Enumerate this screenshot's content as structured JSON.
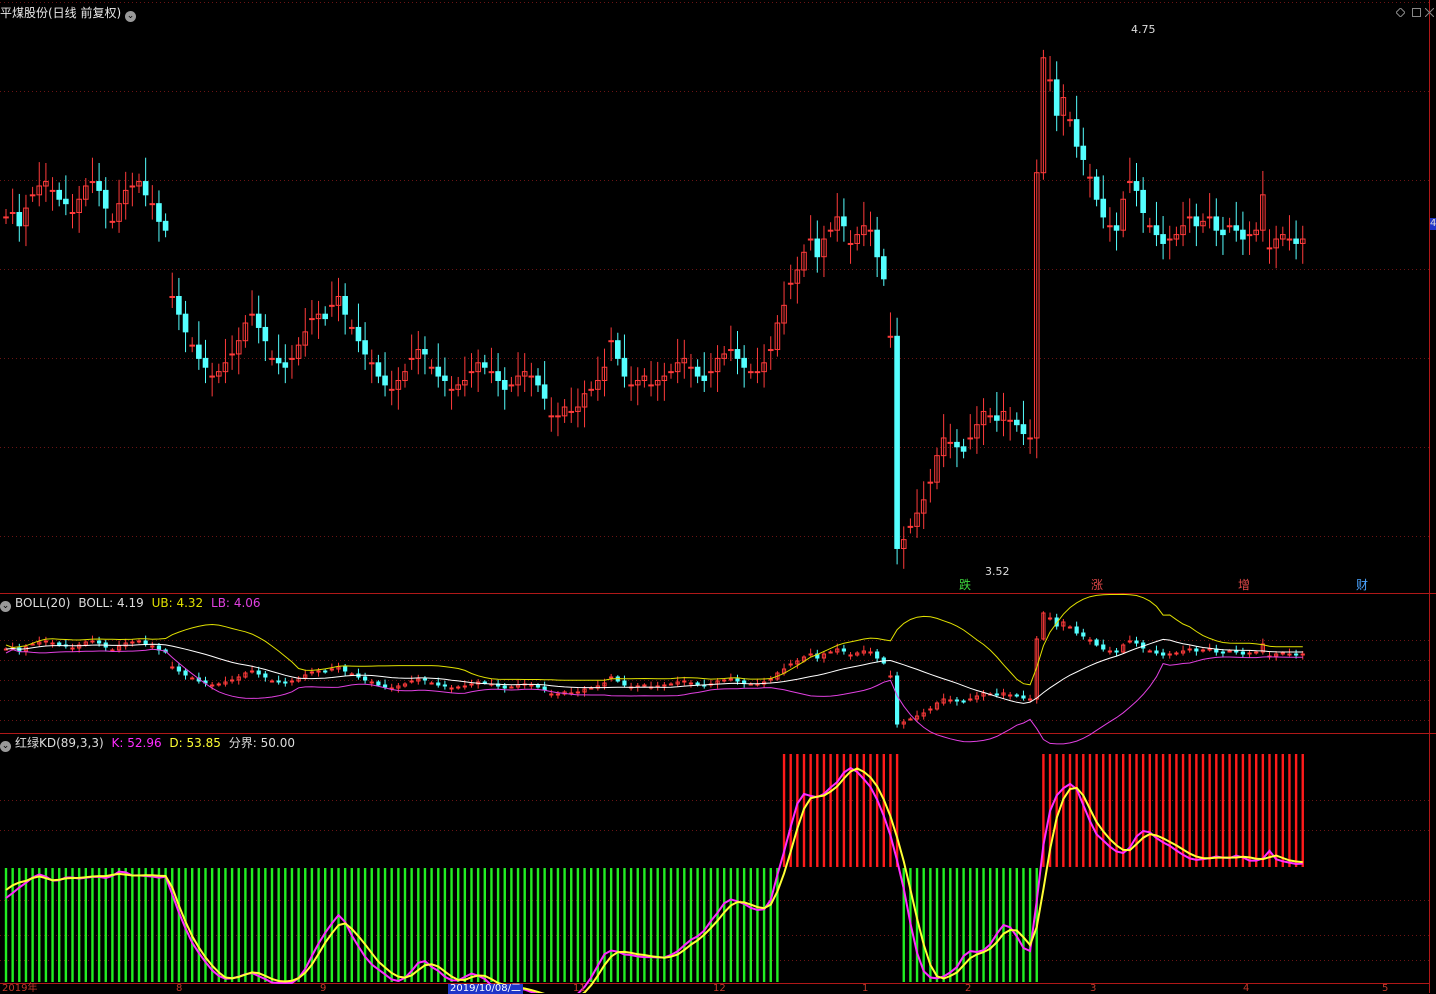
{
  "header": {
    "stock_title": "平煤股份(日线 前复权)"
  },
  "boll": {
    "name": "BOLL(20)",
    "mid_label": "BOLL:",
    "mid": "4.19",
    "ub_label": "UB:",
    "ub": "4.32",
    "lb_label": "LB:",
    "lb": "4.06"
  },
  "kd": {
    "name": "红绿KD(89,3,3)",
    "k_label": "K:",
    "k": "52.96",
    "d_label": "D:",
    "d": "53.85",
    "split_label": "分界:",
    "split": "50.00"
  },
  "price_marks": {
    "high": "4.75",
    "low": "3.52"
  },
  "events": [
    {
      "text": "跌",
      "color": "#3dd63d"
    },
    {
      "text": "涨",
      "color": "#e04848"
    },
    {
      "text": "增",
      "color": "#e04848"
    },
    {
      "text": "财",
      "color": "#4aa3ff"
    }
  ],
  "x_axis": {
    "year": "2019年",
    "selected_date": "2019/10/08/二",
    "months": [
      "8",
      "9",
      "11",
      "12",
      "1",
      "2",
      "3",
      "4",
      "5"
    ]
  },
  "right_edge_value": "4",
  "colors": {
    "up": "#ff3b3b",
    "down": "#54ffff",
    "boll_mid": "#ffffff",
    "boll_ub": "#e0e000",
    "boll_lb": "#e040e0",
    "k_line": "#ff2cff",
    "d_line": "#ffff33",
    "red_bar": "#ff1a1a",
    "green_bar": "#22ee22",
    "frame": "#b01818"
  },
  "chart_data": {
    "type": "candlestick",
    "series": [
      {
        "name": "candles",
        "values": [
          4.31,
          4.32,
          4.29,
          4.33,
          4.36,
          4.38,
          4.39,
          4.37,
          4.35,
          4.34,
          4.32,
          4.35,
          4.38,
          4.39,
          4.37,
          4.33,
          4.3,
          4.34,
          4.37,
          4.38,
          4.39,
          4.36,
          4.34,
          4.3,
          4.28,
          4.13,
          4.09,
          4.05,
          4.02,
          3.99,
          3.97,
          3.95,
          3.96,
          3.98,
          4.0,
          4.03,
          4.07,
          4.09,
          4.06,
          4.03,
          3.99,
          3.98,
          3.97,
          3.99,
          4.02,
          4.05,
          4.08,
          4.09,
          4.08,
          4.11,
          4.13,
          4.09,
          4.06,
          4.03,
          4.0,
          3.98,
          3.95,
          3.93,
          3.92,
          3.94,
          3.96,
          3.99,
          4.01,
          4.0,
          3.97,
          3.95,
          3.94,
          3.92,
          3.93,
          3.94,
          3.96,
          3.98,
          3.97,
          3.96,
          3.94,
          3.92,
          3.93,
          3.95,
          3.96,
          3.95,
          3.93,
          3.9,
          3.86,
          3.86,
          3.88,
          3.87,
          3.88,
          3.91,
          3.92,
          3.94,
          3.97,
          4.03,
          3.99,
          3.95,
          3.93,
          3.94,
          3.95,
          3.93,
          3.94,
          3.95,
          3.96,
          3.98,
          3.99,
          3.97,
          3.95,
          3.94,
          3.96,
          3.99,
          4.0,
          4.01,
          3.99,
          3.97,
          3.96,
          3.96,
          3.98,
          4.01,
          4.07,
          4.11,
          4.16,
          4.19,
          4.23,
          4.26,
          4.22,
          4.26,
          4.28,
          4.31,
          4.29,
          4.25,
          4.27,
          4.29,
          4.28,
          4.22,
          4.17,
          4.04,
          3.56,
          3.58,
          3.61,
          3.64,
          3.67,
          3.71,
          3.77,
          3.81,
          3.8,
          3.79,
          3.78,
          3.81,
          3.84,
          3.87,
          3.86,
          3.85,
          3.87,
          3.85,
          3.84,
          3.82,
          3.81,
          4.41,
          4.67,
          4.62,
          4.54,
          4.58,
          4.53,
          4.47,
          4.44,
          4.4,
          4.35,
          4.31,
          4.29,
          4.28,
          4.35,
          4.39,
          4.37,
          4.32,
          4.29,
          4.27,
          4.25,
          4.26,
          4.27,
          4.29,
          4.31,
          4.29,
          4.3,
          4.31,
          4.28,
          4.27,
          4.29,
          4.28,
          4.26,
          4.27,
          4.28,
          4.36,
          4.24,
          4.26,
          4.27,
          4.26,
          4.25,
          4.26
        ]
      },
      {
        "name": "K",
        "values": [
          30.0,
          33.3,
          37.0,
          40.2,
          43.7,
          45.7,
          44.2,
          41.6,
          41.8,
          43.7,
          43.7,
          42.9,
          43.5,
          44.1,
          44.1,
          43.3,
          44.8,
          47.6,
          47.1,
          45.0,
          45.1,
          44.7,
          44.3,
          43.6,
          44.2,
          32.4,
          20.3,
          9.6,
          0.2,
          -6.7,
          -12.7,
          -18.2,
          -21.9,
          -23.8,
          -23.5,
          -22.4,
          -20.8,
          -20.0,
          -22.1,
          -24.1,
          -26.4,
          -26.7,
          -26.7,
          -26.7,
          -23.3,
          -17.3,
          -8.6,
          -0.3,
          6.8,
          13.1,
          18.6,
          13.9,
          5.0,
          -2.3,
          -9.2,
          -14.3,
          -17.7,
          -20.9,
          -24.3,
          -25.3,
          -23.2,
          -18.5,
          -13.2,
          -12.1,
          -15.9,
          -18.6,
          -22.5,
          -24.8,
          -24.9,
          -22.6,
          -20.4,
          -21.8,
          -24.0,
          -28.2,
          -30.3,
          -30.0,
          -29.6,
          -30.2,
          -31.1,
          -32.7,
          -34.0,
          -35.7,
          -38.0,
          -39.5,
          -39.2,
          -37.4,
          -33.8,
          -29.2,
          -22.9,
          -15.0,
          -7.4,
          -5.0,
          -5.8,
          -7.7,
          -8.0,
          -9.0,
          -9.4,
          -9.3,
          -9.7,
          -9.6,
          -8.0,
          -5.5,
          -1.5,
          2.2,
          4.5,
          8.3,
          14.7,
          20.2,
          26.5,
          29.1,
          27.8,
          26.1,
          23.5,
          22.0,
          22.5,
          28.8,
          45.5,
          61.0,
          77.5,
          92.9,
          99.4,
          98.1,
          97.2,
          99.4,
          103.7,
          107.3,
          113.7,
          116.7,
          114.1,
          109.2,
          104.0,
          95.5,
          84.7,
          71.6,
          55.0,
          36.1,
          13.2,
          -6.7,
          -18.8,
          -23.0,
          -23.5,
          -22.3,
          -19.6,
          -15.9,
          -8.6,
          -5.4,
          -6.0,
          -4.8,
          -0.9,
          6.2,
          12.0,
          10.5,
          4.4,
          -3.3,
          -5.3,
          28.4,
          65.3,
          87.9,
          98.4,
          103.2,
          106.0,
          102.6,
          92.0,
          81.2,
          72.4,
          68.3,
          64.2,
          61.0,
          60.0,
          63.7,
          71.0,
          74.7,
          73.8,
          69.9,
          67.1,
          64.8,
          61.7,
          58.8,
          56.4,
          55.4,
          55.9,
          56.6,
          57.7,
          56.9,
          56.7,
          58.2,
          57.1,
          54.9,
          54.9,
          56.3,
          61.5,
          55.8,
          54.5,
          53.6,
          52.7,
          53.0
        ]
      },
      {
        "name": "D",
        "values": [
          35.4,
          38.5,
          40.3,
          41.4,
          43.3,
          44.4,
          43.2,
          41.8,
          42.2,
          43.1,
          43.3,
          43.4,
          43.8,
          44.3,
          44.6,
          44.6,
          45.4,
          46.1,
          45.6,
          45.0,
          45.0,
          45.2,
          45.2,
          44.8,
          44.7,
          36.9,
          24.9,
          14.1,
          4.6,
          -3.1,
          -9.6,
          -15.1,
          -19.6,
          -23.0,
          -23.5,
          -22.6,
          -21.1,
          -19.6,
          -20.1,
          -21.9,
          -24.0,
          -25.3,
          -25.7,
          -25.2,
          -23.4,
          -19.8,
          -14.3,
          -7.2,
          0.2,
          6.5,
          11.9,
          13.1,
          9.5,
          4.5,
          -0.9,
          -6.8,
          -12.4,
          -16.3,
          -20.0,
          -22.4,
          -23.1,
          -21.5,
          -18.0,
          -14.8,
          -14.2,
          -15.7,
          -19.1,
          -22.3,
          -24.6,
          -24.6,
          -22.8,
          -21.7,
          -21.9,
          -24.1,
          -26.7,
          -28.1,
          -28.9,
          -29.6,
          -30.3,
          -31.4,
          -32.6,
          -33.9,
          -35.9,
          -37.9,
          -38.9,
          -38.4,
          -36.2,
          -33.0,
          -28.1,
          -21.7,
          -14.7,
          -9.1,
          -6.1,
          -5.9,
          -6.5,
          -7.5,
          -8.0,
          -8.8,
          -9.3,
          -9.8,
          -9.1,
          -7.7,
          -4.7,
          -1.1,
          1.8,
          5.6,
          10.1,
          14.9,
          20.4,
          25.1,
          27.3,
          27.1,
          25.6,
          23.9,
          23.2,
          25.7,
          34.3,
          46.5,
          60.9,
          76.5,
          89.5,
          96.6,
          97.6,
          98.3,
          101.0,
          104.5,
          109.7,
          114.4,
          116.3,
          114.1,
          110.4,
          104.4,
          95.6,
          84.4,
          70.4,
          54.3,
          35.7,
          16.2,
          -1.0,
          -14.7,
          -22.2,
          -23.7,
          -22.0,
          -19.6,
          -14.8,
          -10.0,
          -7.6,
          -6.1,
          -3.8,
          0.6,
          6.2,
          8.7,
          8.3,
          3.8,
          -1.3,
          10.8,
          35.8,
          62.2,
          83.5,
          96.1,
          102.7,
          103.4,
          98.4,
          89.3,
          80.6,
          74.4,
          69.2,
          65.1,
          62.1,
          61.9,
          65.9,
          70.2,
          72.6,
          71.7,
          69.8,
          67.4,
          65.1,
          62.3,
          59.6,
          57.6,
          56.6,
          56.5,
          56.9,
          56.9,
          56.9,
          57.0,
          57.5,
          57.1,
          56.2,
          55.9,
          57.2,
          58.3,
          56.7,
          55.1,
          54.3,
          53.9
        ]
      },
      {
        "name": "BOLL",
        "values": [
          4.19
        ]
      },
      {
        "name": "UB",
        "values": [
          4.32
        ]
      },
      {
        "name": "LB",
        "values": [
          4.06
        ]
      }
    ]
  }
}
